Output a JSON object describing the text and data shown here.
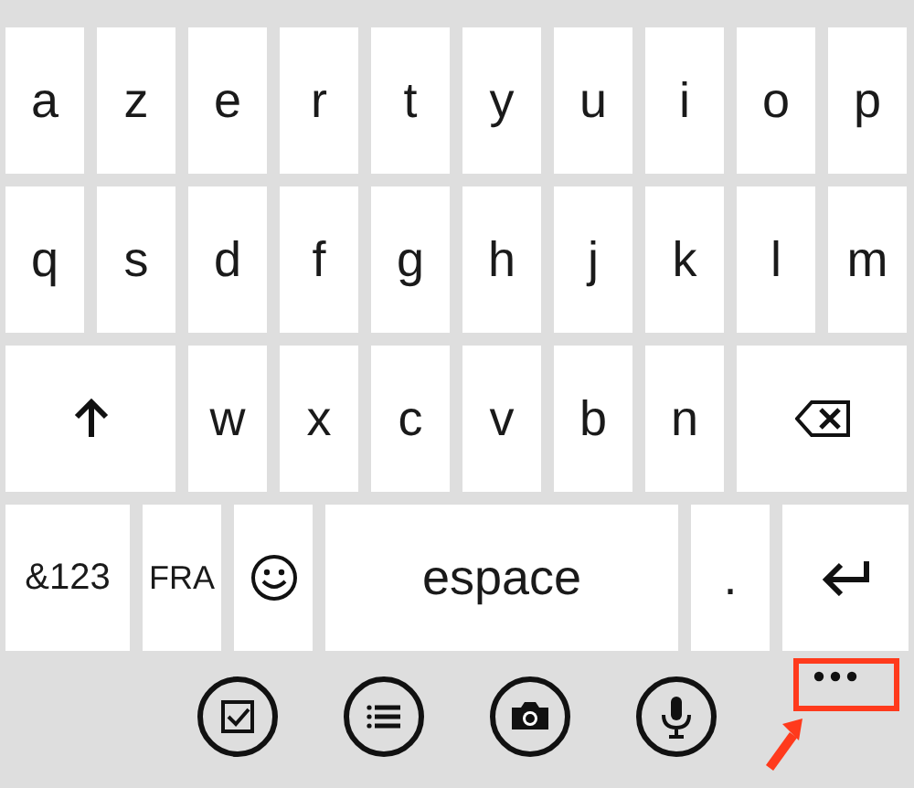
{
  "keyboard": {
    "rows": [
      {
        "keys": [
          {
            "kind": "char",
            "label": "a"
          },
          {
            "kind": "char",
            "label": "z"
          },
          {
            "kind": "char",
            "label": "e"
          },
          {
            "kind": "char",
            "label": "r"
          },
          {
            "kind": "char",
            "label": "t"
          },
          {
            "kind": "char",
            "label": "y"
          },
          {
            "kind": "char",
            "label": "u"
          },
          {
            "kind": "char",
            "label": "i"
          },
          {
            "kind": "char",
            "label": "o"
          },
          {
            "kind": "char",
            "label": "p"
          }
        ]
      },
      {
        "keys": [
          {
            "kind": "char",
            "label": "q"
          },
          {
            "kind": "char",
            "label": "s"
          },
          {
            "kind": "char",
            "label": "d"
          },
          {
            "kind": "char",
            "label": "f"
          },
          {
            "kind": "char",
            "label": "g"
          },
          {
            "kind": "char",
            "label": "h"
          },
          {
            "kind": "char",
            "label": "j"
          },
          {
            "kind": "char",
            "label": "k"
          },
          {
            "kind": "char",
            "label": "l"
          },
          {
            "kind": "char",
            "label": "m"
          }
        ]
      },
      {
        "keys": [
          {
            "kind": "shift"
          },
          {
            "kind": "char",
            "label": "w"
          },
          {
            "kind": "char",
            "label": "x"
          },
          {
            "kind": "char",
            "label": "c"
          },
          {
            "kind": "char",
            "label": "v"
          },
          {
            "kind": "char",
            "label": "b"
          },
          {
            "kind": "char",
            "label": "n"
          },
          {
            "kind": "backspace"
          }
        ]
      },
      {
        "keys": [
          {
            "kind": "symbols",
            "label": "&123"
          },
          {
            "kind": "language",
            "label": "FRA"
          },
          {
            "kind": "emoji"
          },
          {
            "kind": "space",
            "label": "espace"
          },
          {
            "kind": "char",
            "label": "."
          },
          {
            "kind": "enter"
          }
        ]
      }
    ]
  },
  "app_bar": {
    "buttons": [
      {
        "kind": "check"
      },
      {
        "kind": "list"
      },
      {
        "kind": "camera"
      },
      {
        "kind": "mic"
      }
    ],
    "more_button": {
      "highlighted": true
    }
  }
}
